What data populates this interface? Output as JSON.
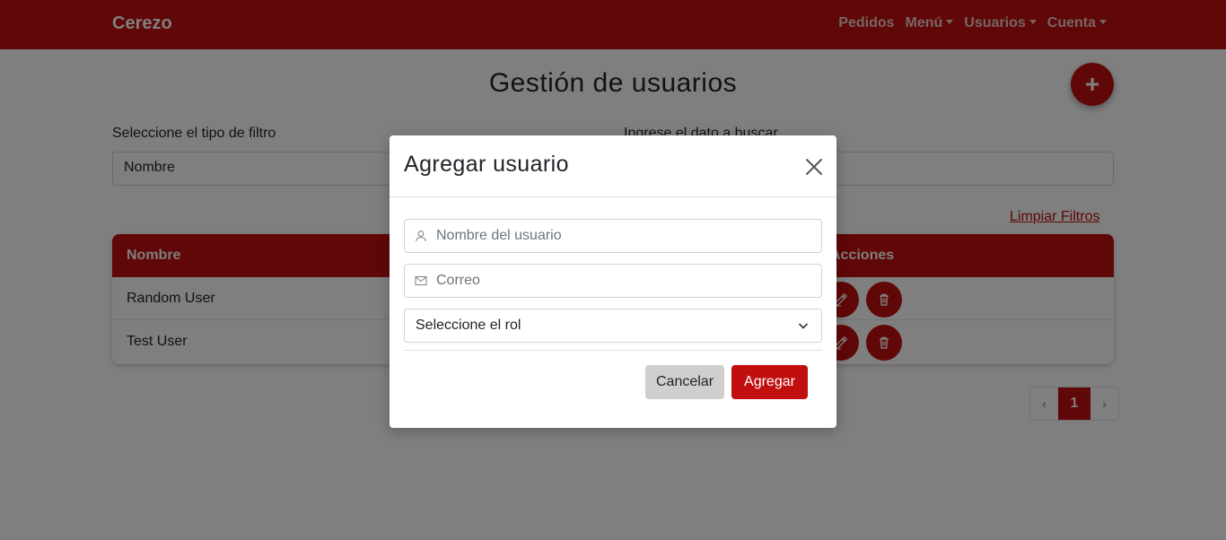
{
  "navbar": {
    "brand": "Cerezo",
    "links": [
      {
        "label": "Pedidos",
        "dropdown": false
      },
      {
        "label": "Menú",
        "dropdown": true
      },
      {
        "label": "Usuarios",
        "dropdown": true
      },
      {
        "label": "Cuenta",
        "dropdown": true
      }
    ]
  },
  "page": {
    "title": "Gestión de usuarios",
    "add_button_label": "+",
    "filter_type_label": "Seleccione el tipo de filtro",
    "filter_type_value": "Nombre",
    "search_label": "Ingrese el dato a buscar",
    "search_value": "",
    "clear_filters": "Limpiar Filtros"
  },
  "table": {
    "columns": [
      "Nombre",
      "Acciones"
    ],
    "rows": [
      {
        "name": "Random User"
      },
      {
        "name": "Test User"
      }
    ]
  },
  "pagination": {
    "prev": "‹",
    "current": "1",
    "next": "›"
  },
  "modal": {
    "title": "Agregar usuario",
    "name_placeholder": "Nombre del usuario",
    "email_placeholder": "Correo",
    "role_select": "Seleccione el rol",
    "cancel_label": "Cancelar",
    "submit_label": "Agregar"
  },
  "colors": {
    "brand": "#c10e0e",
    "backdrop": "rgba(0,0,0,0.5)"
  },
  "icons": {
    "close": "close-icon",
    "user": "user-icon",
    "mail": "mail-icon",
    "chevron": "chevron-down-icon",
    "edit": "edit-icon",
    "delete": "trash-icon"
  }
}
